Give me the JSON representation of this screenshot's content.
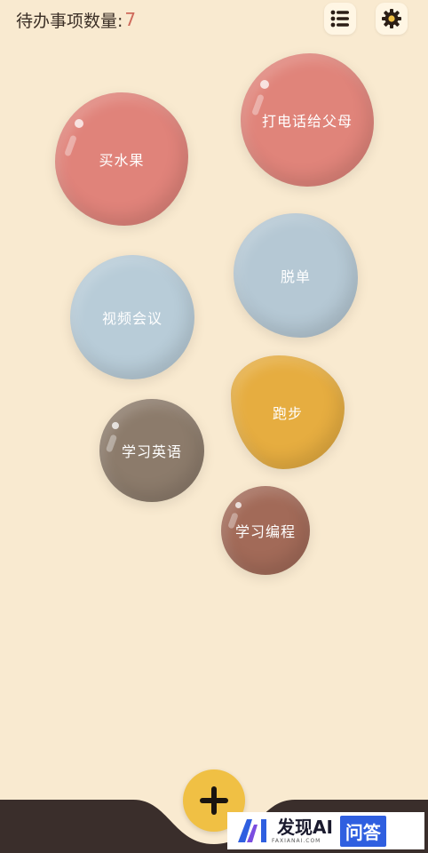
{
  "header": {
    "title": "待办事项数量:",
    "count": "7"
  },
  "toolbar": {
    "list_icon": "list-icon",
    "settings_icon": "gear-icon"
  },
  "todos": [
    {
      "label": "打电话给父母",
      "color": "#e0847a"
    },
    {
      "label": "买水果",
      "color": "#e0837a"
    },
    {
      "label": "脱单",
      "color": "#b5c8d4"
    },
    {
      "label": "视频会议",
      "color": "#b8ccd8"
    },
    {
      "label": "跑步",
      "color": "#e6ad40"
    },
    {
      "label": "学习英语",
      "color": "#8c7b6b"
    },
    {
      "label": "学习编程",
      "color": "#a26a58"
    }
  ],
  "fab": {
    "icon": "plus-icon"
  },
  "colors": {
    "background": "#f9ead0",
    "bottom_bar": "#3a2e2b",
    "fab": "#f0c044",
    "count": "#cf6a5b"
  },
  "watermark": {
    "brand": "发现AI",
    "domain": "FAXIANAI.COM",
    "badge": "问答"
  }
}
